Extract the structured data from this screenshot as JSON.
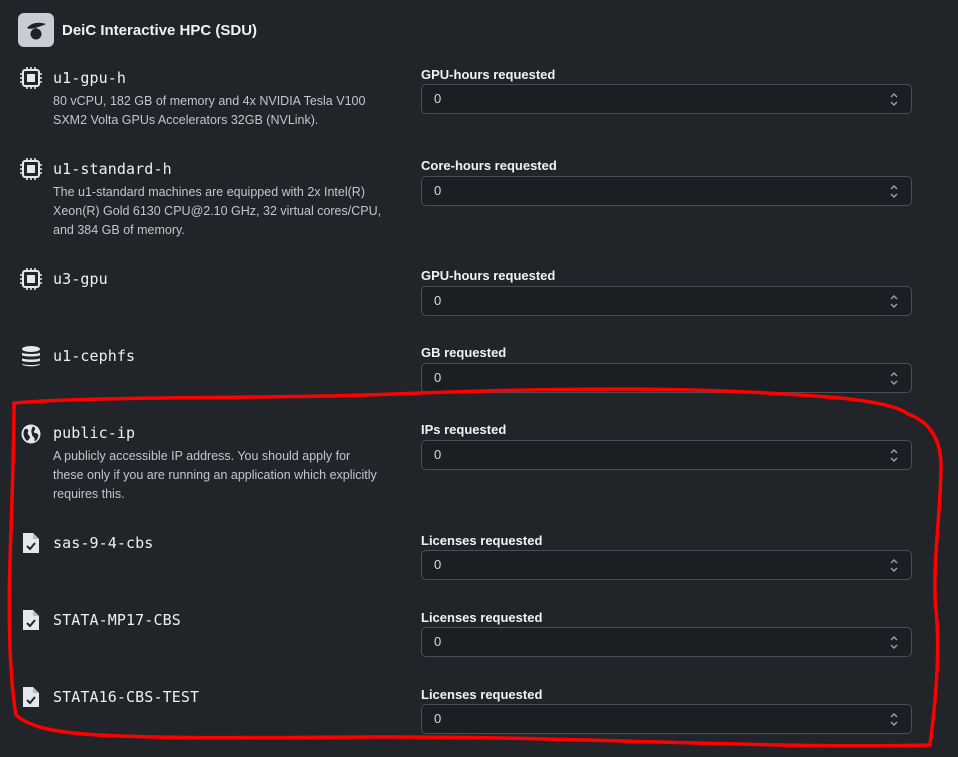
{
  "provider": {
    "title": "DeiC Interactive HPC (SDU)"
  },
  "resources": [
    {
      "name": "u1-gpu-h",
      "icon": "cpu-chip-icon",
      "description_lines": [
        "80 vCPU, 182 GB of memory and 4x NVIDIA Tesla V100",
        "SXM2 Volta GPUs Accelerators 32GB (NVLink)."
      ],
      "field_label": "GPU-hours requested",
      "value": "0"
    },
    {
      "name": "u1-standard-h",
      "icon": "cpu-chip-icon",
      "description_lines": [
        "The u1-standard machines are equipped with 2x Intel(R)",
        "Xeon(R) Gold 6130 CPU@2.10 GHz, 32 virtual cores/CPU,",
        "and 384 GB of memory."
      ],
      "field_label": "Core-hours requested",
      "value": "0"
    },
    {
      "name": "u3-gpu",
      "icon": "cpu-chip-icon",
      "description_lines": [],
      "field_label": "GPU-hours requested",
      "value": "0"
    },
    {
      "name": "u1-cephfs",
      "icon": "database-icon",
      "description_lines": [],
      "field_label": "GB requested",
      "value": "0"
    },
    {
      "name": "public-ip",
      "icon": "globe-icon",
      "description_lines": [
        "A publicly accessible IP address. You should apply for",
        "these only if you are running an application which explicitly",
        "requires this."
      ],
      "field_label": "IPs requested",
      "value": "0"
    },
    {
      "name": "sas-9-4-cbs",
      "icon": "license-file-icon",
      "description_lines": [],
      "field_label": "Licenses requested",
      "value": "0"
    },
    {
      "name": "STATA-MP17-CBS",
      "icon": "license-file-icon",
      "description_lines": [],
      "field_label": "Licenses requested",
      "value": "0"
    },
    {
      "name": "STATA16-CBS-TEST",
      "icon": "license-file-icon",
      "description_lines": [],
      "field_label": "Licenses requested",
      "value": "0"
    }
  ],
  "colors": {
    "background": "#212429",
    "annotation": "#ff0000"
  }
}
